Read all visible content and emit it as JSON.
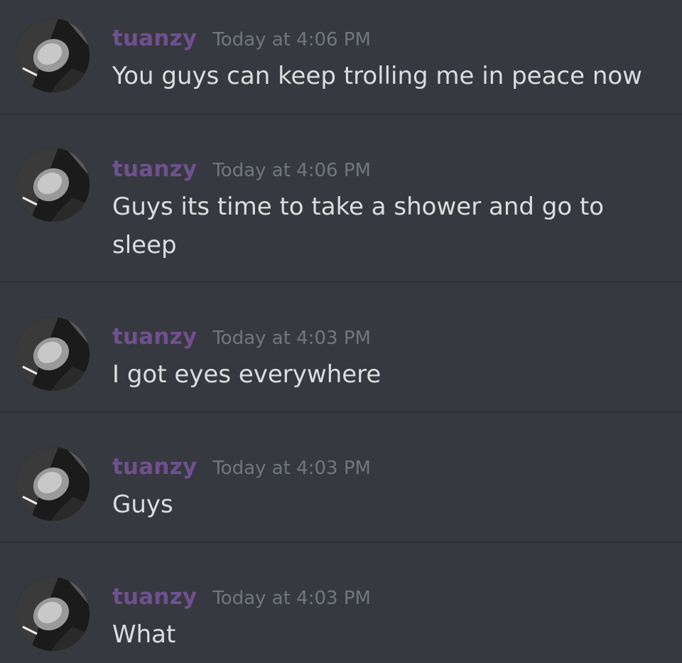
{
  "messages": [
    {
      "username": "tuanzy",
      "timestamp": "Today at 4:06 PM",
      "text": "You guys can keep trolling me in peace now"
    },
    {
      "username": "tuanzy",
      "timestamp": "Today at 4:06 PM",
      "text": "Guys its time to take a shower and go to sleep"
    },
    {
      "username": "tuanzy",
      "timestamp": "Today at 4:03 PM",
      "text": "I got eyes everywhere"
    },
    {
      "username": "tuanzy",
      "timestamp": "Today at 4:03 PM",
      "text": "Guys"
    },
    {
      "username": "tuanzy",
      "timestamp": "Today at 4:03 PM",
      "text": "What"
    }
  ],
  "colors": {
    "background": "#36393f",
    "divider": "#2f3136",
    "username": "#70508f",
    "timestamp": "#72767d",
    "message_text": "#dcddde"
  },
  "icons": {
    "avatar": "grayscale-user-photo"
  }
}
